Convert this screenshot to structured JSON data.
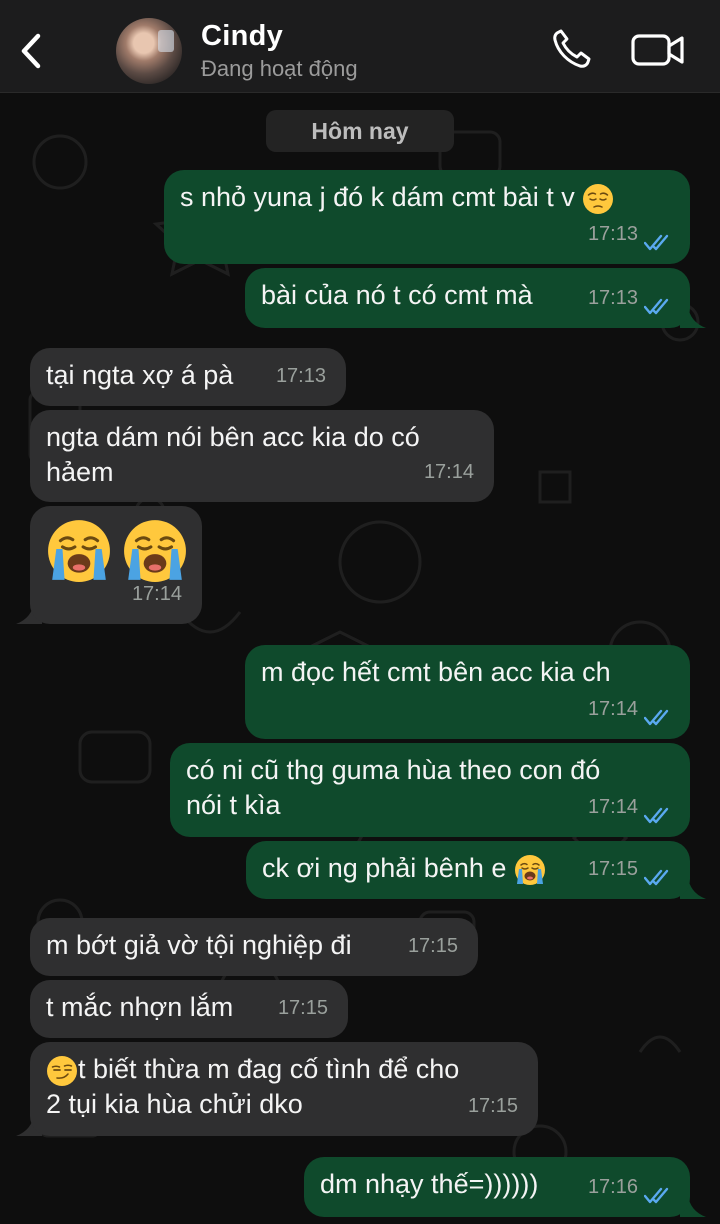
{
  "header": {
    "contact_name": "Cindy",
    "contact_status": "Đang hoạt động",
    "icons": [
      "back-chevron-icon",
      "phone-icon",
      "video-camera-icon"
    ]
  },
  "chat": {
    "date_label": "Hôm nay",
    "messages": [
      {
        "direction": "out",
        "text": "s nhỏ yuna j đó k dám cmt bài t v",
        "emoji_after": "pensive-face-emoji",
        "time": "17:13",
        "status": "read"
      },
      {
        "direction": "out",
        "text": "bài của nó t có cmt mà",
        "time": "17:13",
        "status": "read"
      },
      {
        "direction": "in",
        "text": "tại ngta xợ á pà",
        "time": "17:13"
      },
      {
        "direction": "in",
        "text": "ngta dám nói bên acc kia do có hảem",
        "line1": "ngta dám nói bên acc kia do có",
        "line2": "hảem",
        "time": "17:14"
      },
      {
        "direction": "in",
        "emojis": [
          "loudly-crying-face-emoji",
          "loudly-crying-face-emoji"
        ],
        "time": "17:14"
      },
      {
        "direction": "out",
        "text": "m đọc hết cmt bên acc kia ch",
        "time": "17:14",
        "status": "read"
      },
      {
        "direction": "out",
        "text": "có ni cũ thg guma hùa theo con đó nói t kìa",
        "line1": "có ni cũ thg guma hùa theo con đó",
        "line2": "nói t kìa",
        "time": "17:14",
        "status": "read"
      },
      {
        "direction": "out",
        "text": "ck ơi ng phải bênh e",
        "emoji_after": "loudly-crying-face-emoji",
        "time": "17:15",
        "status": "read"
      },
      {
        "direction": "in",
        "text": "m bớt giả vờ tội nghiệp đi",
        "time": "17:15"
      },
      {
        "direction": "in",
        "text": "t mắc nhợn lắm",
        "time": "17:15"
      },
      {
        "direction": "in",
        "emoji_before": "smirking-face-emoji",
        "text": "t biết thừa m đag cố tình để cho 2 tụi kia hùa chửi dko",
        "line1": "t biết thừa m đag cố tình để cho",
        "line2": "2 tụi kia hùa chửi dko",
        "time": "17:15"
      },
      {
        "direction": "out",
        "text": "dm nhạy thế=))))))",
        "time": "17:16",
        "status": "read"
      }
    ]
  },
  "colors": {
    "background": "#0e0e0e",
    "header": "#1c1c1d",
    "outgoing_bubble": "#0f4a2c",
    "incoming_bubble": "#2f2f30",
    "read_ticks": "#5aa9ef",
    "timestamp": "#9aa09c"
  }
}
